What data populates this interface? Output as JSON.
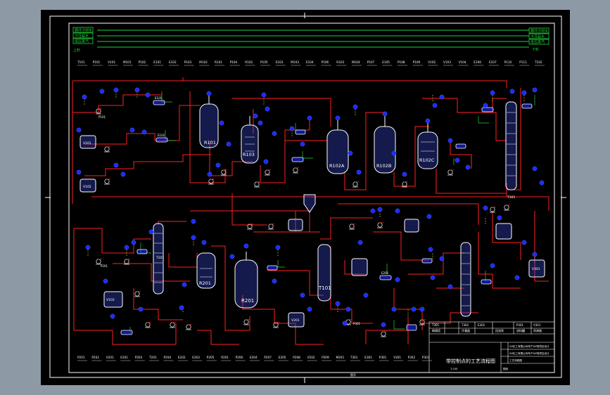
{
  "colors": {
    "app_background": "#8e99a6",
    "sheet_background": "#000000",
    "frame": "#ffffff",
    "process_line": "#ff2020",
    "equipment_outline": "#ffffff",
    "equipment_fill": "#3a4bd6",
    "instrument": "#1a2cff",
    "utility_line": "#22d23a",
    "signal_line": "#e0e020"
  },
  "utility_legend_left": [
    "循环冷却水",
    "冷冻盐水",
    "低压蒸汽",
    "上料"
  ],
  "utility_legend_right": [
    "循环冷却水",
    "冷冻盐水",
    "低压蒸汽",
    "下料"
  ],
  "equipment_tags": {
    "reactor_r101": "R101",
    "reactor_r103": "R103",
    "reactor_r102a": "R102A",
    "reactor_r102b": "R102B",
    "reactor_r102c": "R102C",
    "reactor_r201": "R201",
    "tower_t101": "T101",
    "tower_t201": "T201",
    "tower_t301": "T301",
    "exchanger_e101": "E101",
    "exchanger_e102": "E102",
    "exchanger_e201": "E201",
    "tank_v101": "V101",
    "tank_v201": "V201",
    "tank_v301": "V301",
    "pump_p101": "P101",
    "pump_p201": "P201",
    "pump_p301": "P301",
    "vessel_v102": "V102",
    "vessel_v103": "V103"
  },
  "header_tags": [
    "T101",
    "P101",
    "V101",
    "M101",
    "P102",
    "E101",
    "E102",
    "P103",
    "M102",
    "R101",
    "P104",
    "R102",
    "P105",
    "E103",
    "M103",
    "E104",
    "P106",
    "R103",
    "M104",
    "P107",
    "E105",
    "P108",
    "P109",
    "V102",
    "V103",
    "V104",
    "E106",
    "E107",
    "P110",
    "P111",
    "T102"
  ],
  "footer_tags": [
    "P201",
    "P202",
    "V201",
    "E201",
    "P203",
    "T201",
    "P204",
    "E202",
    "E203",
    "P205",
    "R201",
    "P206",
    "E204",
    "P207",
    "E205",
    "P208",
    "V202",
    "P209",
    "M201",
    "T301",
    "E301",
    "P301",
    "V301",
    "P302",
    "P303"
  ],
  "title_block": {
    "drawing_title": "带控制点的工艺流程图",
    "rev_rows": [
      "T301",
      "T302",
      "E301",
      "P301",
      "V301"
    ],
    "rev_notes": [
      "精馏塔",
      "冷凝器",
      "回流泵",
      "进料罐",
      "再沸器"
    ],
    "info_row_1": "XX化工有限公司年产XX吨项目设计",
    "info_row_2": "XX化工有限公司年产XX吨项目设计",
    "drawing_no": "工艺流程图",
    "sheet_label": "图纸",
    "scale_label": "1:100"
  },
  "footer_caption": "图号"
}
